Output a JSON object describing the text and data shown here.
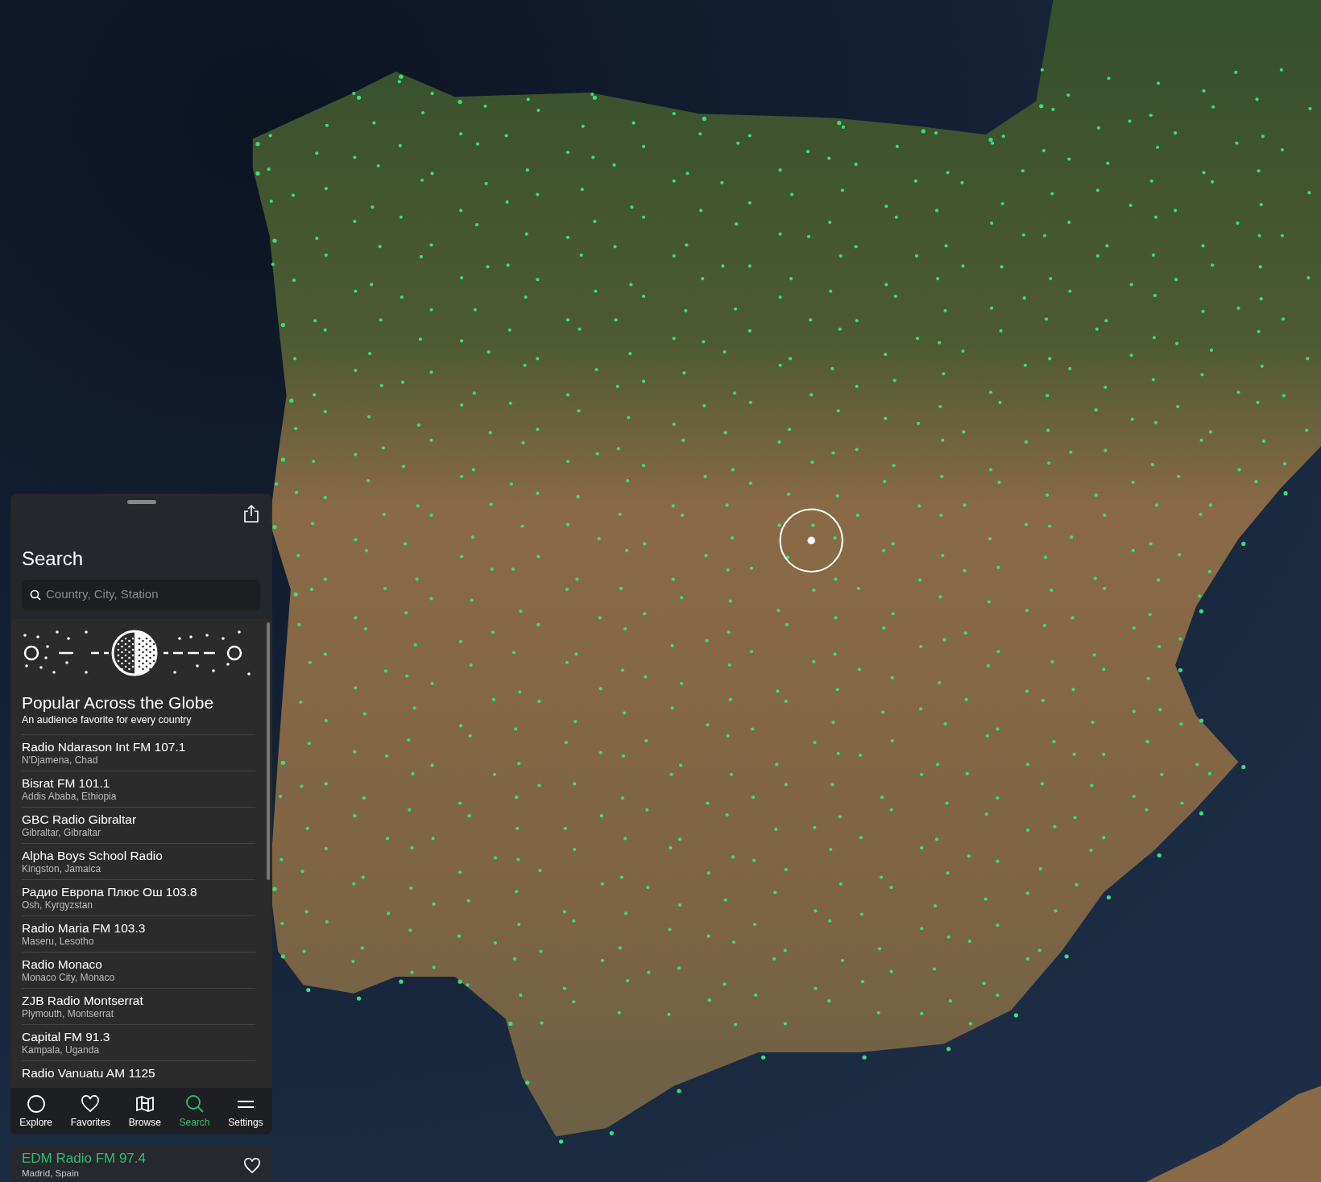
{
  "panel": {
    "title": "Search",
    "search": {
      "placeholder": "Country, City, Station"
    },
    "section": {
      "title": "Popular Across the Globe",
      "subtitle": "An audience favorite for every country"
    },
    "stations": [
      {
        "name": "Radio Ndarason Int FM 107.1",
        "location": "N'Djamena, Chad"
      },
      {
        "name": "Bisrat FM 101.1",
        "location": "Addis Ababa, Ethiopia"
      },
      {
        "name": "GBC Radio Gibraltar",
        "location": "Gibraltar, Gibraltar"
      },
      {
        "name": "Alpha Boys School Radio",
        "location": "Kingston, Jamaica"
      },
      {
        "name": "Радио Европа Плюс Ош 103.8",
        "location": "Osh, Kyrgyzstan"
      },
      {
        "name": "Radio Maria FM 103.3",
        "location": "Maseru, Lesotho"
      },
      {
        "name": "Radio Monaco",
        "location": "Monaco City, Monaco"
      },
      {
        "name": "ZJB Radio Montserrat",
        "location": "Plymouth, Montserrat"
      },
      {
        "name": "Capital FM 91.3",
        "location": "Kampala, Uganda"
      },
      {
        "name": "Radio Vanuatu AM 1125"
      }
    ],
    "tabs": [
      {
        "label": "Explore",
        "kind": "circle",
        "selected": false
      },
      {
        "label": "Favorites",
        "kind": "heart",
        "selected": false
      },
      {
        "label": "Browse",
        "kind": "map",
        "selected": false
      },
      {
        "label": "Search",
        "kind": "search",
        "selected": true
      },
      {
        "label": "Settings",
        "kind": "menu",
        "selected": false
      }
    ],
    "now_playing": {
      "name": "EDM Radio FM 97.4",
      "location": "Madrid, Spain",
      "favorite": false
    }
  }
}
